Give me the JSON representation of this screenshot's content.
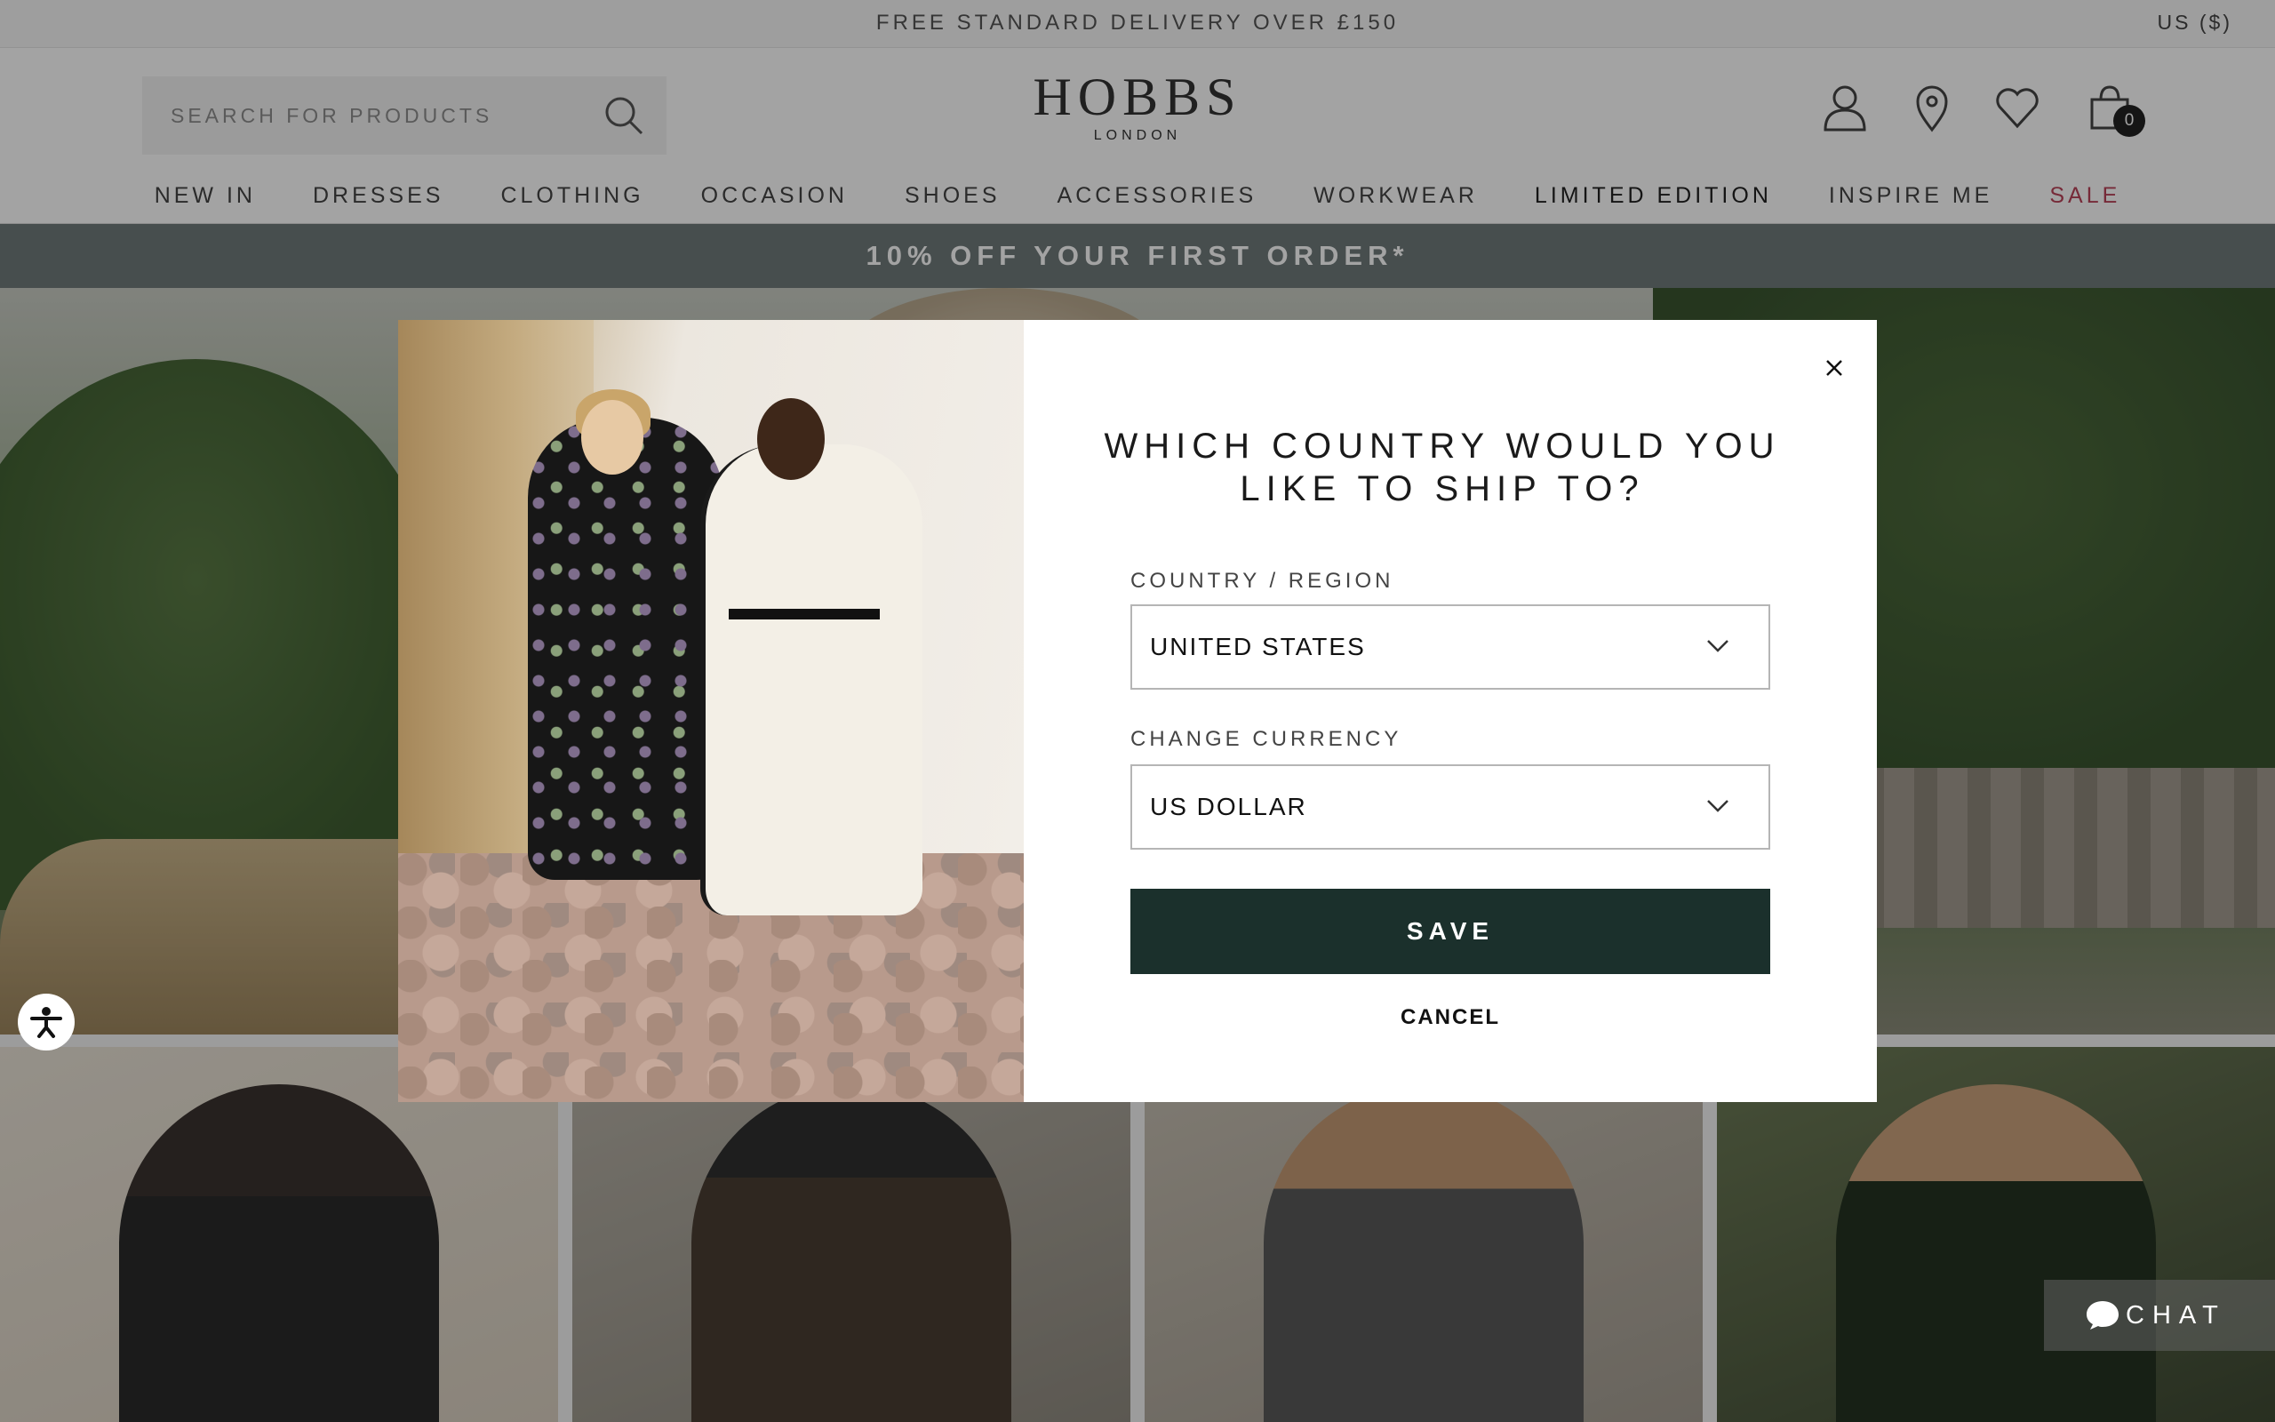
{
  "top_strip": {
    "delivery_text": "FREE STANDARD DELIVERY OVER £150",
    "locale": "US ($)"
  },
  "header": {
    "search_placeholder": "SEARCH FOR PRODUCTS",
    "logo_brand": "HOBBS",
    "logo_sub": "LONDON",
    "bag_count": "0",
    "icons": [
      "search-icon",
      "account-icon",
      "store-locator-icon",
      "wishlist-icon",
      "bag-icon"
    ]
  },
  "nav": {
    "items": [
      "NEW IN",
      "DRESSES",
      "CLOTHING",
      "OCCASION",
      "SHOES",
      "ACCESSORIES",
      "WORKWEAR",
      "LIMITED EDITION",
      "INSPIRE ME",
      "SALE"
    ]
  },
  "offer_bar": {
    "text": "10% OFF YOUR FIRST ORDER*"
  },
  "modal": {
    "title": "WHICH COUNTRY WOULD YOU LIKE TO SHIP TO?",
    "country_label": "COUNTRY / REGION",
    "country_value": "UNITED STATES",
    "currency_label": "CHANGE CURRENCY",
    "currency_value": "US DOLLAR",
    "save_label": "SAVE",
    "cancel_label": "CANCEL"
  },
  "chat": {
    "label": "CHAT"
  },
  "colors": {
    "save_button": "#1b302c",
    "offer_bar": "#6f7a7a",
    "sale": "#b94258"
  }
}
